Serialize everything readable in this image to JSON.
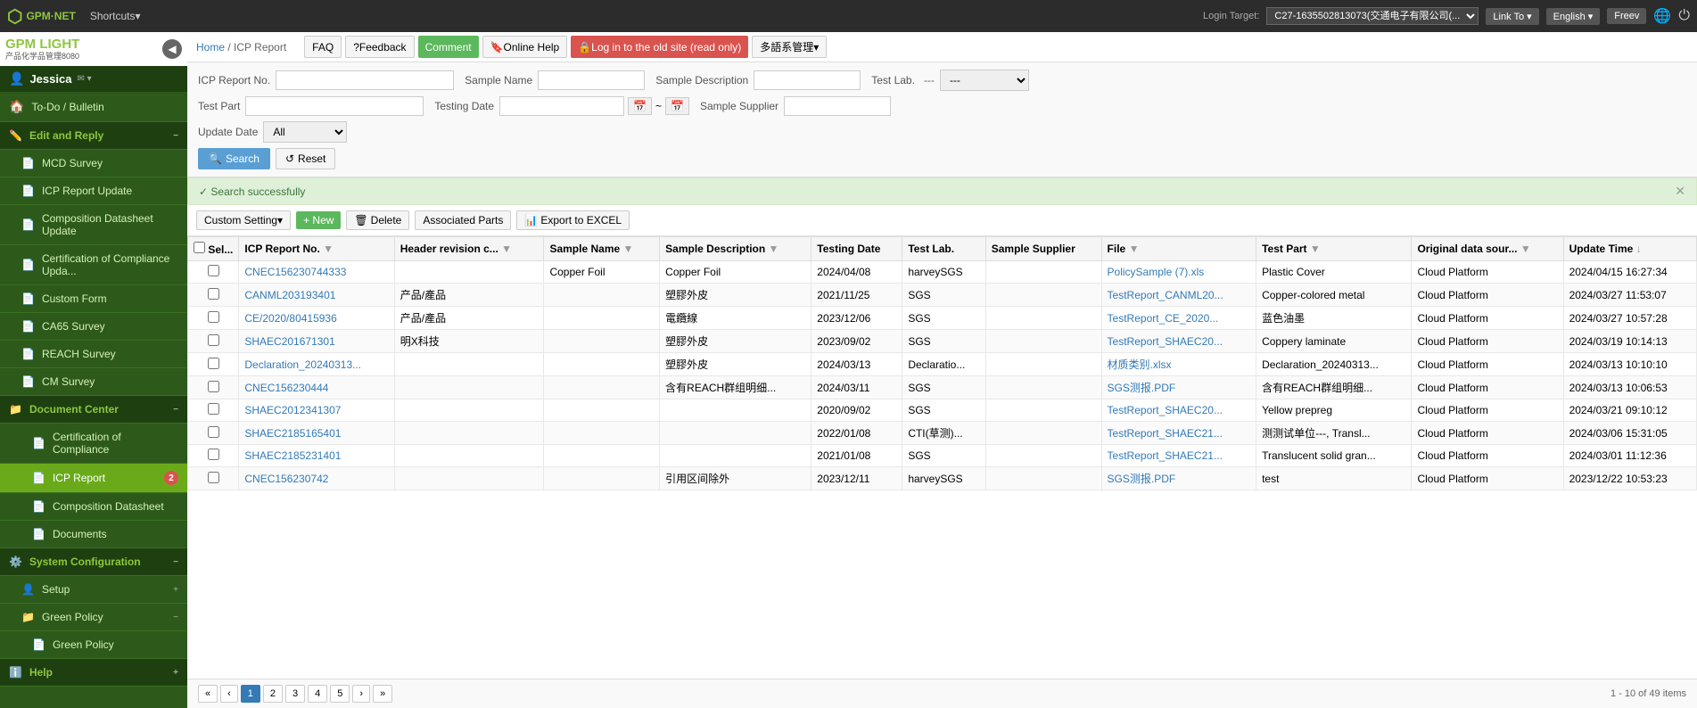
{
  "topbar": {
    "logo": "GPM·NET",
    "shortcuts": "Shortcuts▾",
    "login_target_label": "Login Target:",
    "login_target_value": "C27-1635502813073(交通电子有限公司(...",
    "link_to": "Link To ▾",
    "english": "English ▾",
    "freev": "Freev",
    "globe_icon": "🌐",
    "logout_icon": "⏻"
  },
  "sidebar": {
    "user": "Jessica",
    "nav_items": [
      {
        "id": "todo",
        "label": "To-Do / Bulletin",
        "icon": "🏠",
        "type": "main"
      },
      {
        "id": "edit-reply",
        "label": "Edit and Reply",
        "icon": "✏️",
        "type": "section",
        "collapsible": true
      },
      {
        "id": "mcd-survey",
        "label": "MCD Survey",
        "icon": "📄",
        "type": "sub"
      },
      {
        "id": "icp-report-update",
        "label": "ICP Report Update",
        "icon": "📄",
        "type": "sub"
      },
      {
        "id": "composition-datasheet",
        "label": "Composition Datasheet Update",
        "icon": "📄",
        "type": "sub"
      },
      {
        "id": "cert-compliance-update",
        "label": "Certification of Compliance Upda...",
        "icon": "📄",
        "type": "sub"
      },
      {
        "id": "custom-form",
        "label": "Custom Form",
        "icon": "📄",
        "type": "sub"
      },
      {
        "id": "ca65-survey",
        "label": "CA65 Survey",
        "icon": "📄",
        "type": "sub"
      },
      {
        "id": "reach-survey",
        "label": "REACH Survey",
        "icon": "📄",
        "type": "sub"
      },
      {
        "id": "cm-survey",
        "label": "CM Survey",
        "icon": "📄",
        "type": "sub"
      },
      {
        "id": "document-center",
        "label": "Document Center",
        "icon": "📁",
        "type": "section",
        "collapsible": true
      },
      {
        "id": "cert-compliance",
        "label": "Certification of Compliance",
        "icon": "📄",
        "type": "sub-deep"
      },
      {
        "id": "icp-report",
        "label": "ICP Report",
        "icon": "📄",
        "type": "sub-deep",
        "active": true
      },
      {
        "id": "composition-datasheet2",
        "label": "Composition Datasheet",
        "icon": "📄",
        "type": "sub-deep"
      },
      {
        "id": "documents",
        "label": "Documents",
        "icon": "📄",
        "type": "sub-deep"
      },
      {
        "id": "system-config",
        "label": "System Configuration",
        "icon": "⚙️",
        "type": "section",
        "collapsible": true
      },
      {
        "id": "setup",
        "label": "Setup",
        "icon": "👤",
        "type": "sub",
        "collapsible": true
      },
      {
        "id": "green-policy",
        "label": "Green Policy",
        "icon": "📁",
        "type": "sub",
        "collapsible": true
      },
      {
        "id": "green-policy-sub",
        "label": "Green Policy",
        "icon": "📄",
        "type": "sub-deep"
      },
      {
        "id": "help",
        "label": "Help",
        "icon": "ℹ️",
        "type": "section",
        "collapsible": true
      }
    ]
  },
  "header": {
    "breadcrumb_home": "Home",
    "breadcrumb_sep": " / ",
    "breadcrumb_current": "ICP Report",
    "btn_faq": "FAQ",
    "btn_feedback": "?Feedback",
    "btn_comment": "Comment",
    "btn_online_help": "🔖Online Help",
    "btn_old_site": "🔒Log in to the old site (read only)",
    "btn_lang": "多語系管理▾"
  },
  "search_form": {
    "icp_report_no_label": "ICP Report No.",
    "icp_report_no_value": "",
    "sample_name_label": "Sample Name",
    "sample_name_value": "",
    "sample_desc_label": "Sample Description",
    "sample_desc_value": "",
    "test_lab_label": "Test Lab.",
    "test_lab_value": "---",
    "test_part_label": "Test Part",
    "test_part_value": "",
    "testing_date_label": "Testing Date",
    "testing_date_from": "",
    "testing_date_to": "",
    "sample_supplier_label": "Sample Supplier",
    "sample_supplier_value": "",
    "update_date_label": "Update Date",
    "update_date_value": "All",
    "btn_search": "Search",
    "btn_reset": "Reset"
  },
  "success_bar": {
    "message": "✓ Search successfully"
  },
  "toolbar": {
    "btn_custom_setting": "Custom Setting▾",
    "btn_new": "+ New",
    "btn_delete": "Delete",
    "btn_assoc": "Associated Parts",
    "btn_export": "Export to EXCEL",
    "badge": "2"
  },
  "table": {
    "columns": [
      "Sel...",
      "ICP Report No.",
      "Header revision c...",
      "Sample Name",
      "Sample Description",
      "Testing Date",
      "Test Lab.",
      "Sample Supplier",
      "File",
      "Test Part",
      "Original data sour...",
      "Update Time"
    ],
    "rows": [
      {
        "icp_no": "CNEC156230744333",
        "header_rev": "",
        "sample_name": "Copper Foil",
        "sample_desc": "Copper Foil",
        "testing_date": "2024/04/08",
        "test_lab": "harveySGS",
        "sample_supplier": "",
        "file": "PolicySample (7).xls",
        "test_part": "Plastic Cover",
        "original": "Cloud Platform",
        "update_time": "2024/04/15 16:27:34"
      },
      {
        "icp_no": "CANML203193401",
        "header_rev": "产品/產品",
        "sample_name": "",
        "sample_desc": "塑膠外皮",
        "testing_date": "2021/11/25",
        "test_lab": "SGS",
        "sample_supplier": "",
        "file": "TestReport_CANML20...",
        "test_part": "Copper-colored metal",
        "original": "Cloud Platform",
        "update_time": "2024/03/27 11:53:07"
      },
      {
        "icp_no": "CE/2020/80415936",
        "header_rev": "产品/產品",
        "sample_name": "",
        "sample_desc": "電纜線",
        "testing_date": "2023/12/06",
        "test_lab": "SGS",
        "sample_supplier": "",
        "file": "TestReport_CE_2020...",
        "test_part": "蓝色油墨",
        "original": "Cloud Platform",
        "update_time": "2024/03/27 10:57:28"
      },
      {
        "icp_no": "SHAEC201671301",
        "header_rev": "明X科技",
        "sample_name": "",
        "sample_desc": "塑膠外皮",
        "testing_date": "2023/09/02",
        "test_lab": "SGS",
        "sample_supplier": "",
        "file": "TestReport_SHAEC20...",
        "test_part": "Coppery laminate",
        "original": "Cloud Platform",
        "update_time": "2024/03/19 10:14:13"
      },
      {
        "icp_no": "Declaration_20240313...",
        "header_rev": "",
        "sample_name": "",
        "sample_desc": "塑膠外皮",
        "testing_date": "2024/03/13",
        "test_lab": "Declaratio...",
        "sample_supplier": "",
        "file": "材质类别.xlsx",
        "test_part": "Declaration_20240313...",
        "original": "Cloud Platform",
        "update_time": "2024/03/13 10:10:10"
      },
      {
        "icp_no": "CNEC156230444",
        "header_rev": "",
        "sample_name": "",
        "sample_desc": "含有REACH群组明细...",
        "testing_date": "2024/03/11",
        "test_lab": "SGS",
        "sample_supplier": "",
        "file": "SGS测报.PDF",
        "test_part": "含有REACH群组明细...",
        "original": "Cloud Platform",
        "update_time": "2024/03/13 10:06:53"
      },
      {
        "icp_no": "SHAEC2012341307",
        "header_rev": "",
        "sample_name": "",
        "sample_desc": "",
        "testing_date": "2020/09/02",
        "test_lab": "SGS",
        "sample_supplier": "",
        "file": "TestReport_SHAEC20...",
        "test_part": "Yellow prepreg",
        "original": "Cloud Platform",
        "update_time": "2024/03/21 09:10:12"
      },
      {
        "icp_no": "SHAEC2185165401",
        "header_rev": "",
        "sample_name": "",
        "sample_desc": "",
        "testing_date": "2022/01/08",
        "test_lab": "CTI(草测)...",
        "sample_supplier": "",
        "file": "TestReport_SHAEC21...",
        "test_part": "测测试单位---, Transl...",
        "original": "Cloud Platform",
        "update_time": "2024/03/06 15:31:05"
      },
      {
        "icp_no": "SHAEC2185231401",
        "header_rev": "",
        "sample_name": "",
        "sample_desc": "",
        "testing_date": "2021/01/08",
        "test_lab": "SGS",
        "sample_supplier": "",
        "file": "TestReport_SHAEC21...",
        "test_part": "Translucent solid gran...",
        "original": "Cloud Platform",
        "update_time": "2024/03/01 11:12:36"
      },
      {
        "icp_no": "CNEC156230742",
        "header_rev": "",
        "sample_name": "",
        "sample_desc": "引用区间除外",
        "testing_date": "2023/12/11",
        "test_lab": "harveySGS",
        "sample_supplier": "",
        "file": "SGS测报.PDF",
        "test_part": "test",
        "original": "Cloud Platform",
        "update_time": "2023/12/22 10:53:23"
      }
    ]
  },
  "pagination": {
    "first": "«",
    "prev": "‹",
    "pages": [
      "1",
      "2",
      "3",
      "4",
      "5"
    ],
    "next": "›",
    "last": "»",
    "active_page": "1",
    "summary": "1 - 10 of 49 items"
  }
}
